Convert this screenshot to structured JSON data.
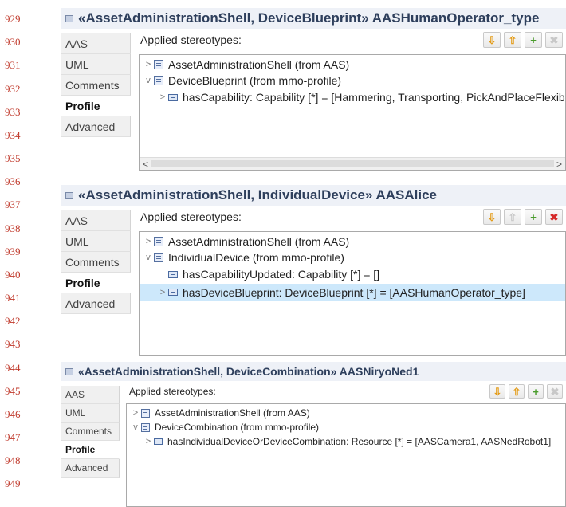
{
  "line_numbers": [
    "929",
    "930",
    "931",
    "932",
    "933",
    "934",
    "935",
    "936",
    "937",
    "938",
    "939",
    "940",
    "941",
    "942",
    "943",
    "944",
    "945",
    "946",
    "947",
    "948",
    "949"
  ],
  "panels": [
    {
      "title": "«AssetAdministrationShell, DeviceBlueprint» AASHumanOperator_type",
      "tabs": [
        "AAS",
        "UML",
        "Comments",
        "Profile",
        "Advanced"
      ],
      "active_tab": "Profile",
      "applied_label": "Applied stereotypes:",
      "rows": [
        {
          "chevron": ">",
          "icon": "stereotype-icon",
          "text": "AssetAdministrationShell   (from AAS)"
        },
        {
          "chevron": "v",
          "icon": "stereotype-icon",
          "text": "DeviceBlueprint   (from mmo-profile)"
        },
        {
          "chevron": ">",
          "icon": "property-icon",
          "text": "hasCapability: Capability [*] = [Hammering, Transporting, PickAndPlaceFlexib"
        }
      ]
    },
    {
      "title": "«AssetAdministrationShell, IndividualDevice» AASAlice",
      "tabs": [
        "AAS",
        "UML",
        "Comments",
        "Profile",
        "Advanced"
      ],
      "active_tab": "Profile",
      "applied_label": "Applied stereotypes:",
      "rows": [
        {
          "chevron": ">",
          "icon": "stereotype-icon",
          "text": "AssetAdministrationShell   (from AAS)"
        },
        {
          "chevron": "v",
          "icon": "stereotype-icon",
          "text": "IndividualDevice   (from mmo-profile)"
        },
        {
          "chevron": "",
          "icon": "property-icon",
          "text": "hasCapabilityUpdated: Capability [*] = []"
        },
        {
          "chevron": ">",
          "icon": "property-icon",
          "text": "hasDeviceBlueprint: DeviceBlueprint [*] = [AASHumanOperator_type]",
          "selected": true
        }
      ]
    },
    {
      "title": "«AssetAdministrationShell, DeviceCombination» AASNiryoNed1",
      "tabs": [
        "AAS",
        "UML",
        "Comments",
        "Profile",
        "Advanced"
      ],
      "active_tab": "Profile",
      "applied_label": "Applied stereotypes:",
      "rows": [
        {
          "chevron": ">",
          "icon": "stereotype-icon",
          "text": "AssetAdministrationShell   (from AAS)"
        },
        {
          "chevron": "v",
          "icon": "stereotype-icon",
          "text": "DeviceCombination   (from mmo-profile)"
        },
        {
          "chevron": ">",
          "icon": "property-icon",
          "text": "hasIndividualDeviceOrDeviceCombination: Resource [*] = [AASCamera1, AASNedRobot1]"
        }
      ]
    }
  ],
  "buttons": {
    "down": "⇩",
    "up": "⇧",
    "add": "+",
    "delete": "✖"
  },
  "scrollbar": {
    "left": "<",
    "right": ">"
  }
}
